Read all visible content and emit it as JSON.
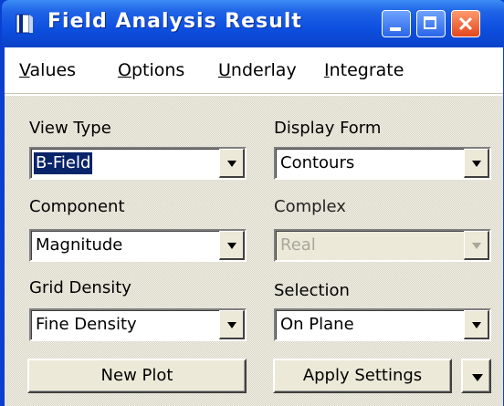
{
  "window": {
    "title": "Field Analysis Result",
    "controls": {
      "minimize": "minimize-icon",
      "maximize": "maximize-icon",
      "close": "close-icon"
    }
  },
  "menubar": {
    "items": [
      {
        "label": "Values",
        "mnemonic": "V"
      },
      {
        "label": "Options",
        "mnemonic": "O"
      },
      {
        "label": "Underlay",
        "mnemonic": "U"
      },
      {
        "label": "Integrate",
        "mnemonic": "I"
      }
    ]
  },
  "form": {
    "view_type": {
      "label": "View Type",
      "value": "B-Field",
      "focused": true
    },
    "display_form": {
      "label": "Display Form",
      "value": "Contours"
    },
    "component": {
      "label": "Component",
      "value": "Magnitude"
    },
    "complex": {
      "label": "Complex",
      "value": "Real",
      "enabled": false
    },
    "grid_density": {
      "label": "Grid Density",
      "value": "Fine Density"
    },
    "selection": {
      "label": "Selection",
      "value": "On Plane"
    }
  },
  "buttons": {
    "new_plot": "New Plot",
    "apply_settings": "Apply Settings"
  },
  "colors": {
    "titlebar": "#0d4fe0",
    "selection_highlight": "#0a246a",
    "face": "#ece9d8",
    "close_button": "#e2471e"
  }
}
